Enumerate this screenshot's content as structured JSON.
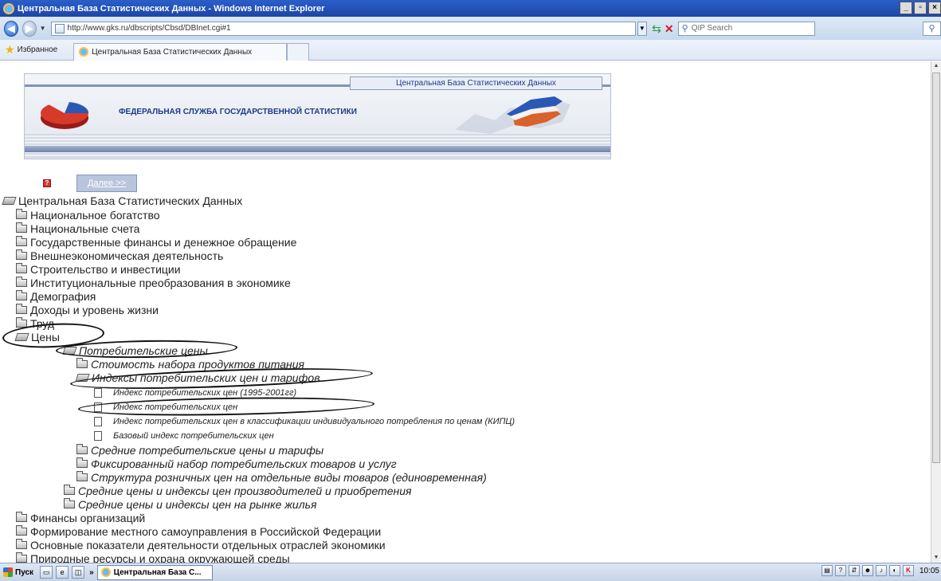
{
  "window": {
    "title": "Центральная База Статистических Данных - Windows Internet Explorer"
  },
  "addressbar": {
    "url": "http://www.gks.ru/dbscripts/Cbsd/DBInet.cgi#1",
    "search_placeholder": "QIP Search"
  },
  "favbar": {
    "favorites_label": "Избранное",
    "tab_title": "Центральная База Статистических Данных"
  },
  "banner": {
    "top_title": "Центральная База Статистических Данных",
    "subtitle": "ФЕДЕРАЛЬНАЯ СЛУЖБА ГОСУДАРСТВЕННОЙ СТАТИСТИКИ"
  },
  "toolbar": {
    "help_label": "?",
    "next_label": "Далее >>"
  },
  "tree": {
    "root": "Центральная База Статистических Данных",
    "items": [
      "Национальное богатство",
      "Национальные счета",
      "Государственные финансы и денежное обращение",
      "Внешнеэкономическая деятельность",
      "Строительство и инвестиции",
      "Институциональные преобразования в экономике",
      "Демография",
      "Доходы и уровень жизни",
      "Труд",
      "Цены",
      "Потребительские цены",
      "Стоимость набора продуктов питания",
      "Индексы потребительских цен и тарифов",
      "Индекс потребительских цен (1995-2001гг)",
      "Индекс потребительских цен",
      "Индекс потребительских цен в классификации индивидуального потребления по ценам (КИПЦ)",
      "Базовый индекс потребительских цен",
      "Средние потребительские цены и тарифы",
      "Фиксированный набор потребительских товаров и услуг",
      "Структура розничных цен на отдельные виды товаров (единовременная)",
      "Средние цены и индексы цен производителей и приобретения",
      "Средние цены и индексы цен на рынке жилья",
      "Финансы организаций",
      "Формирование местного самоуправления в Российской Федерации",
      "Основные показатели деятельности отдельных отраслей экономики",
      "Природные ресурсы и охрана окружающей среды"
    ]
  },
  "taskbar": {
    "start_label": "Пуск",
    "chevron": "»",
    "task_label": "Центральная База С...",
    "clock": "10:05"
  },
  "colors": {
    "titlebar": "#1c45a8",
    "banner_text": "#1b3a8a",
    "help_icon": "#d73535"
  }
}
